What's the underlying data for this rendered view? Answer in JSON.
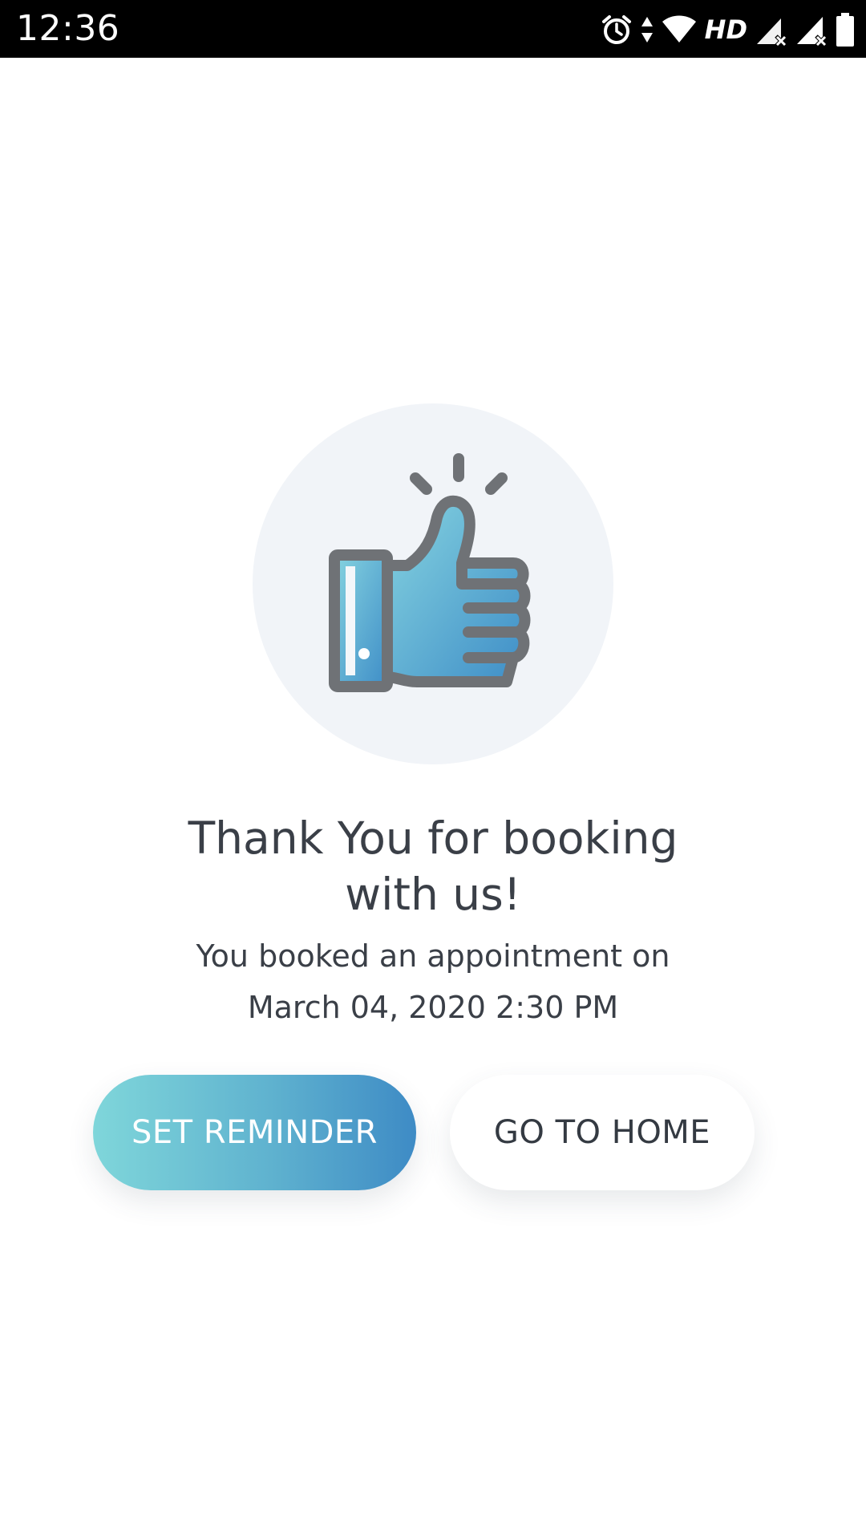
{
  "status_bar": {
    "time": "12:36",
    "network_label": "HD",
    "icons": [
      "alarm-icon",
      "data-arrows-icon",
      "wifi-icon",
      "signal-icon",
      "signal-icon",
      "battery-icon"
    ]
  },
  "hero": {
    "icon": "thumbs-up-icon"
  },
  "message": {
    "title_line1": "Thank You for booking",
    "title_line2": "with us!",
    "detail_line1": "You booked an appointment on",
    "detail_line2": "March 04, 2020 2:30 PM"
  },
  "actions": {
    "set_reminder_label": "SET REMINDER",
    "go_home_label": "GO TO HOME"
  },
  "colors": {
    "text": "#3a3f47",
    "circle_bg": "#f1f4f8",
    "gradient_start": "#7fd6da",
    "gradient_end": "#3e8bc5",
    "icon_stroke": "#6f7276"
  }
}
